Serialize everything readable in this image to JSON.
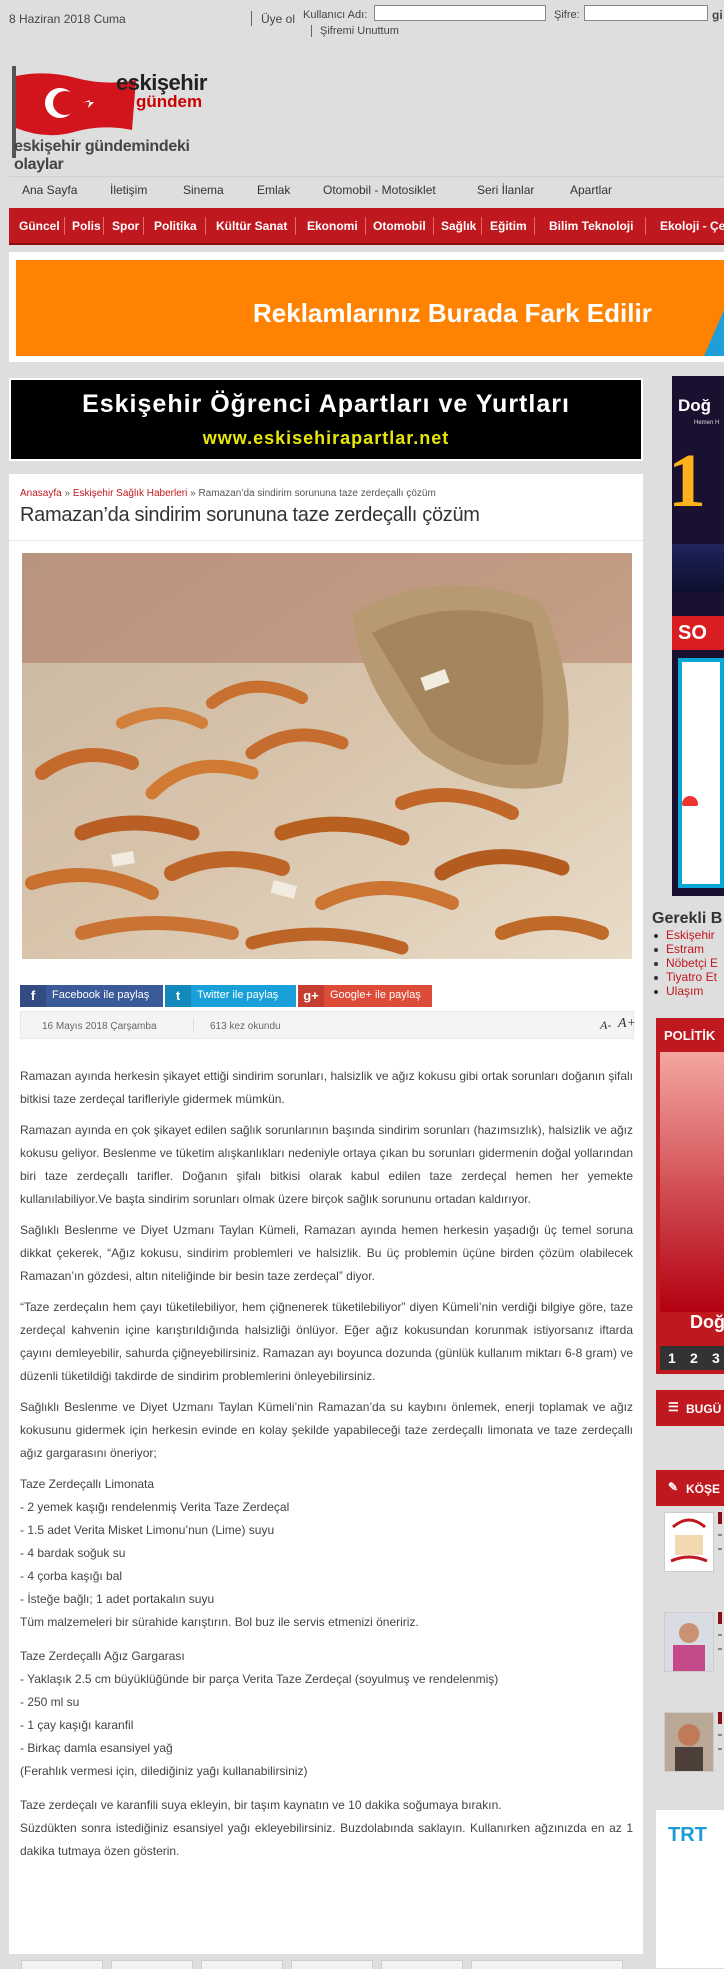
{
  "topbar": {
    "date": "8 Haziran 2018 Cuma",
    "register": "Üye ol",
    "username_label": "Kullanıcı Adı:",
    "password_label": "Şifre:",
    "login": "gi",
    "forgot": "Şifremi Unuttum"
  },
  "logo": {
    "name_line1": "eskişehir",
    "name_line2": "gündem",
    "tagline": "eskişehir gündemindeki olaylar",
    "icon": "turkish-flag-icon"
  },
  "main_nav": [
    "Ana Sayfa",
    "İletişim",
    "Sinema",
    "Emlak",
    "Otomobil - Motosiklet",
    "Seri İlanlar",
    "Apartlar"
  ],
  "category_nav": [
    "Güncel",
    "Polis",
    "Spor",
    "Politika",
    "Kültür Sanat",
    "Ekonomi",
    "Otomobil",
    "Sağlık",
    "Eğitim",
    "Bilim Teknoloji",
    "Ekoloji - Çe"
  ],
  "ads": {
    "banner_text": "Reklamlarınız Burada Fark Edilir",
    "apart_title": "Eskişehir Öğrenci Apartları ve Yurtları",
    "apart_url": "www.eskisehirapartlar.net"
  },
  "article": {
    "breadcrumb": {
      "home": "Anasayfa",
      "sep": "»",
      "category": "Eskişehir Sağlık Haberleri",
      "current": "Ramazan’da sindirim sorununa taze zerdeçallı çözüm"
    },
    "title": "Ramazan’da sindirim sorununa taze zerdeçallı çözüm",
    "share": {
      "facebook": "Facebook ile paylaş",
      "twitter": "Twitter ile paylaş",
      "google": "Google+ ile paylaş",
      "facebook_icon": "f",
      "twitter_icon": "t",
      "google_icon": "g+"
    },
    "date": "16 Mayıs 2018 Çarşamba",
    "views": "613 kez okundu",
    "font_small": "A-",
    "font_large": "A+",
    "paragraphs": [
      "Ramazan ayında herkesin şikayet ettiği sindirim sorunları, halsizlik ve ağız kokusu gibi ortak sorunları doğanın şifalı bitkisi taze zerdeçal tarifleriyle gidermek mümkün.",
      "Ramazan ayında en çok şikayet edilen sağlık sorunlarının başında sindirim sorunları (hazımsızlık), halsizlik ve ağız kokusu geliyor. Beslenme ve tüketim alışkanlıkları nedeniyle ortaya çıkan bu sorunları gidermenin doğal yollarından biri taze zerdeçallı tarifler. Doğanın şifalı bitkisi olarak kabul edilen taze zerdeçal hemen her yemekte kullanılabiliyor.Ve başta sindirim sorunları olmak üzere birçok sağlık sorununu ortadan kaldırıyor.",
      "Sağlıklı Beslenme ve Diyet Uzmanı Taylan Kümeli, Ramazan ayında hemen herkesin yaşadığı üç temel soruna dikkat çekerek, “Ağız kokusu, sindirim problemleri ve halsizlik. Bu üç problemin üçüne birden çözüm olabilecek Ramazan’ın gözdesi, altın niteliğinde bir besin taze zerdeçal” diyor.",
      "“Taze zerdeçalın hem çayı tüketilebiliyor, hem çiğnenerek tüketilebiliyor” diyen Kümeli’nin verdiği bilgiye göre, taze zerdeçal kahvenin içine karıştırıldığında halsizliği önlüyor. Eğer ağız kokusundan korunmak istiyorsanız iftarda çayını demleyebilir, sahurda çiğneyebilirsiniz. Ramazan ayı boyunca dozunda (günlük kullanım miktarı 6-8 gram) ve düzenli tüketildiği takdirde de sindirim problemlerini önleyebilirsiniz.",
      "Sağlıklı Beslenme ve Diyet Uzmanı Taylan Kümeli’nin Ramazan’da su kaybını önlemek, enerji toplamak ve ağız kokusunu gidermek için herkesin evinde en kolay şekilde yapabileceği taze zerdeçallı limonata ve taze zerdeçallı ağız gargarasını öneriyor;"
    ],
    "recipe1": [
      "Taze Zerdeçallı Limonata",
      "- 2 yemek kaşığı rendelenmiş Verita Taze Zerdeçal",
      "- 1.5 adet Verita Misket Limonu’nun (Lime) suyu",
      "- 4 bardak soğuk su",
      "- 4 çorba kaşığı bal",
      "- İsteğe bağlı; 1 adet portakalın suyu",
      "Tüm malzemeleri bir sürahide karıştırın. Bol buz ile servis etmenizi öneririz."
    ],
    "recipe2": [
      "Taze Zerdeçallı Ağız Gargarası",
      "- Yaklaşık 2.5 cm büyüklüğünde bir parça Verita Taze Zerdeçal (soyulmuş ve rendelenmiş)",
      "- 250 ml su",
      "- 1 çay kaşığı karanfil",
      "- Birkaç damla esansiyel yağ",
      "(Ferahlık vermesi için, dilediğiniz yağı kullanabilirsiniz)"
    ],
    "closing": [
      "Taze zerdeçalı ve karanfili suya ekleyin, bir taşım kaynatın ve 10 dakika soğumaya bırakın.",
      "Süzdükten sonra istediğiniz esansiyel yağı ekleyebilirsiniz. Buzdolabında saklayın. Kullanırken ağzınızda en az 1 dakika tutmaya özen gösterin."
    ]
  },
  "sidebar": {
    "ad_title": "Doğ",
    "ad_sub": "Hemen H",
    "ad_big": "1",
    "ad_sale": "SO",
    "important_title": "Gerekli B",
    "links": [
      "Eskişehir",
      "Estram",
      "Nöbetçi E",
      "Tiyatro Et",
      "Ulaşım"
    ],
    "politics_label": "POLİTİK",
    "politics_caption": "Doğ",
    "pager": [
      "1",
      "2",
      "3"
    ],
    "today_label": "BUGÜ",
    "columns_label": "KÖŞE",
    "trt_logo": "TRT"
  },
  "colors": {
    "brand_red": "#c0181f",
    "banner_orange": "#ff8200",
    "facebook": "#3b5a99",
    "twitter": "#19a0d8",
    "google": "#dd4b39"
  }
}
